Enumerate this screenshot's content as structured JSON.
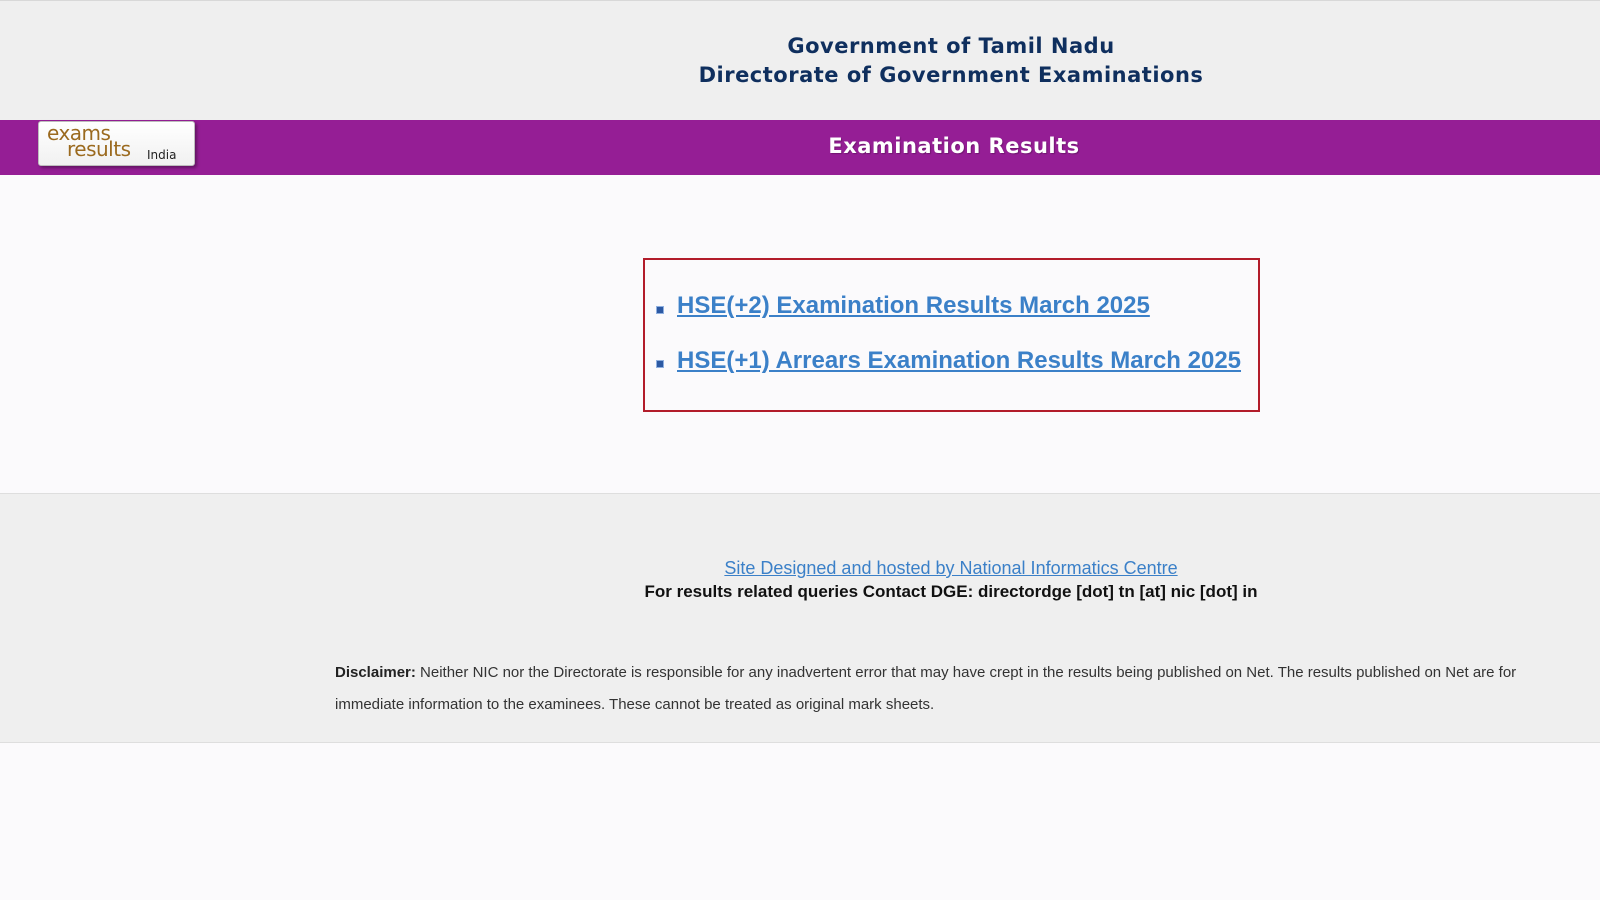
{
  "header": {
    "line1": "Government of Tamil Nadu",
    "line2": "Directorate of Government Examinations"
  },
  "logo": {
    "word1": "exams",
    "word2": "results",
    "word3": "India"
  },
  "banner": {
    "title": "Examination Results"
  },
  "results": [
    {
      "label": "HSE(+2) Examination Results March 2025"
    },
    {
      "label": "HSE(+1) Arrears Examination Results March 2025"
    }
  ],
  "footer": {
    "credit_link": "Site Designed and hosted by National Informatics Centre",
    "contact": "For results related queries Contact DGE:  directordge [dot] tn [at] nic [dot] in",
    "disclaimer_label": "Disclaimer:",
    "disclaimer_text": " Neither NIC nor the Directorate is responsible for any inadvertent error that may have crept in the results being published on Net. The results published on Net are for immediate information to the examinees. These cannot be treated as original mark sheets."
  },
  "colors": {
    "banner_purple": "#951e95",
    "header_navy": "#0f2f5e",
    "link_blue": "#3b80c8",
    "box_border_red": "#b21c2a"
  }
}
